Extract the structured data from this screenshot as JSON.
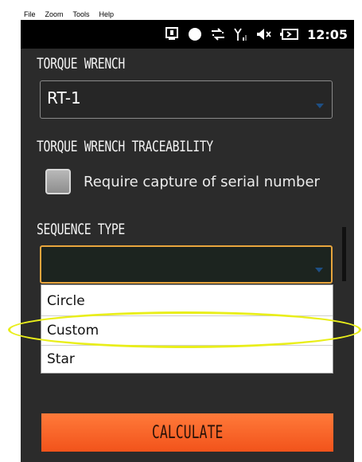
{
  "menubar": {
    "file": "File",
    "zoom": "Zoom",
    "tools": "Tools",
    "help": "Help"
  },
  "statusbar": {
    "time": "12:05",
    "icons": [
      "notification-icon",
      "record-dot-icon",
      "data-sync-icon",
      "signal-icon",
      "volume-icon",
      "battery-icon"
    ]
  },
  "torque_wrench": {
    "label": "TORQUE WRENCH",
    "value": "RT-1"
  },
  "traceability": {
    "label": "TORQUE WRENCH TRACEABILITY",
    "checkbox_label": "Require capture of serial number",
    "checked": false
  },
  "sequence_type": {
    "label": "SEQUENCE TYPE",
    "value": "",
    "options": [
      "Circle",
      "Custom",
      "Star"
    ]
  },
  "calculate_label": "CALCULATE",
  "colors": {
    "accent": "#e8a53d",
    "button": "#f2531b",
    "highlight": "#e9ee1a"
  }
}
